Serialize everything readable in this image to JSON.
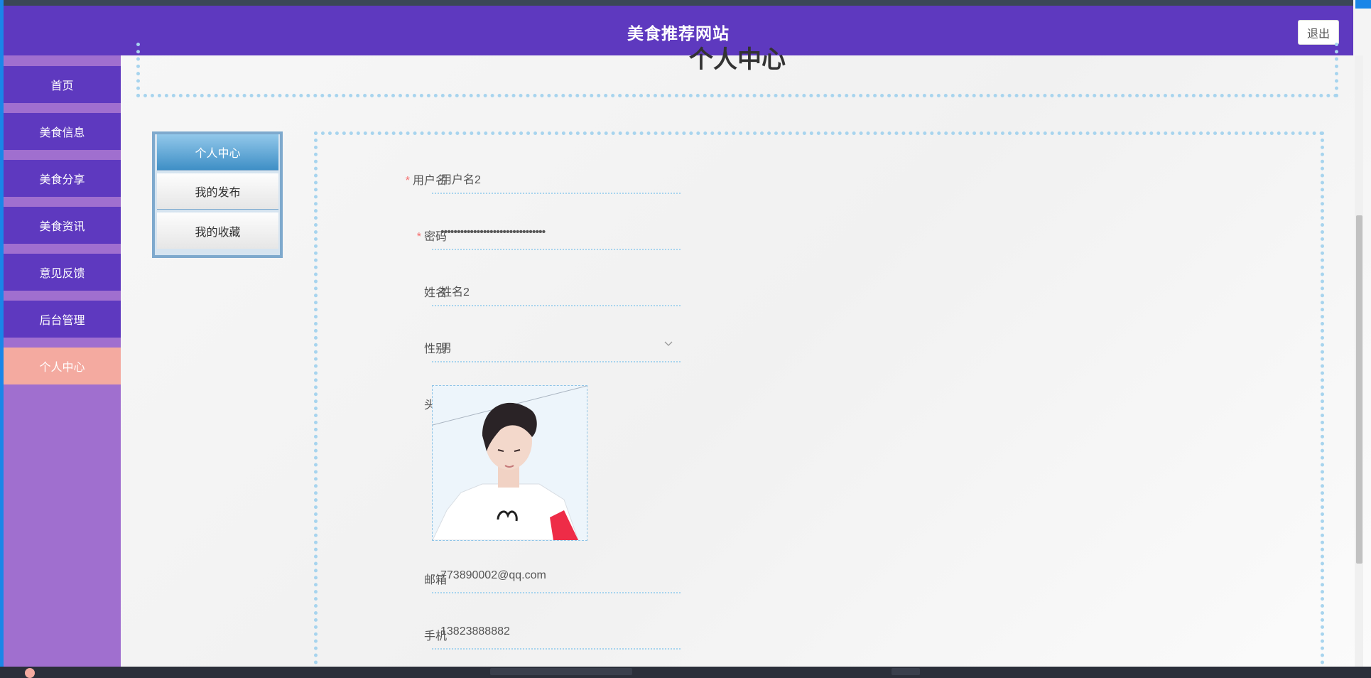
{
  "header": {
    "site_title": "美食推荐网站",
    "logout_label": "退出",
    "colors": {
      "bar": "#5e39bf"
    }
  },
  "sidebar": {
    "items": [
      {
        "label": "首页"
      },
      {
        "label": "美食信息"
      },
      {
        "label": "美食分享"
      },
      {
        "label": "美食资讯"
      },
      {
        "label": "意见反馈"
      },
      {
        "label": "后台管理"
      },
      {
        "label": "个人中心",
        "active": true
      }
    ],
    "colors": {
      "item": "#5e39bf",
      "active": "#f4aaa0",
      "background": "#a06fcf"
    }
  },
  "page": {
    "title": "个人中心"
  },
  "submenu": {
    "items": [
      {
        "label": "个人中心",
        "active": true
      },
      {
        "label": "我的发布"
      },
      {
        "label": "我的收藏"
      }
    ]
  },
  "form": {
    "username": {
      "label": "用户名",
      "required": true,
      "value": "用户名2"
    },
    "password": {
      "label": "密码",
      "required": true,
      "value": "••••••••••••••••••••••••••••••••"
    },
    "name": {
      "label": "姓名",
      "value": "姓名2"
    },
    "gender": {
      "label": "性别",
      "value": "男",
      "icon": "chevron-down-icon"
    },
    "avatar": {
      "label": "头像"
    },
    "email": {
      "label": "邮箱",
      "value": "773890002@qq.com"
    },
    "phone": {
      "label": "手机",
      "value": "13823888882"
    },
    "required_mark": "*"
  }
}
